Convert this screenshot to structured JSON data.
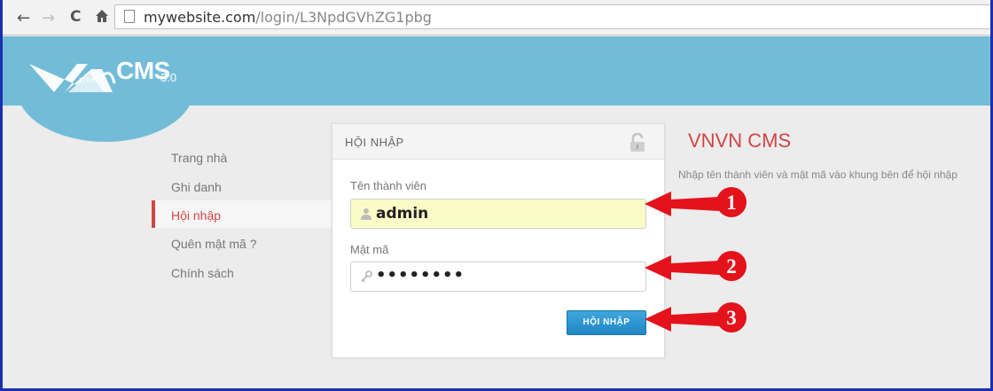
{
  "browser": {
    "url_domain": "mywebsite.com",
    "url_path": "/login/L3NpdGVhZG1pbg"
  },
  "header": {
    "logo_mark": "vnvn",
    "logo_text": "CMS",
    "logo_version": "3.0"
  },
  "menu": {
    "items": [
      {
        "label": "Trang nhà"
      },
      {
        "label": "Ghi danh"
      },
      {
        "label": "Hội nhập"
      },
      {
        "label": "Quên mật mã ?"
      },
      {
        "label": "Chính sách"
      }
    ],
    "active_index": 2
  },
  "login": {
    "title": "HỘI NHẬP",
    "username_label": "Tên thành viên",
    "username_value": "admin",
    "password_label": "Mật mã",
    "password_value": "••••••••",
    "submit_label": "HỘI NHẬP"
  },
  "info": {
    "title": "VNVN CMS",
    "description": "Nhập tên thành viên và mật mã vào khung bên để hội nhập"
  },
  "annotations": [
    "1",
    "2",
    "3"
  ],
  "colors": {
    "accent": "#d14545",
    "header": "#72bcd8",
    "button": "#1f86c4",
    "annotation": "#e4121b"
  },
  "icons": [
    "back-arrow-icon",
    "forward-arrow-icon",
    "reload-icon",
    "home-icon",
    "page-icon",
    "lock-icon",
    "user-icon",
    "key-icon"
  ]
}
